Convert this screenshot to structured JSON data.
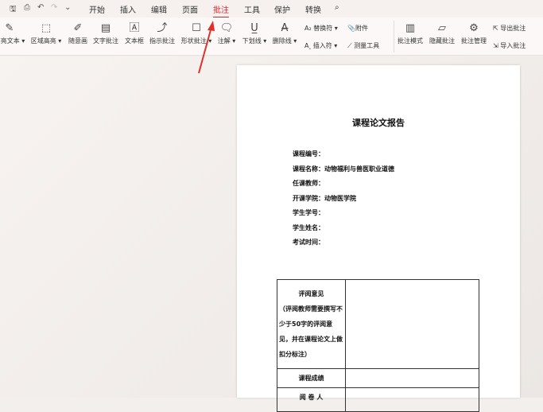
{
  "quick_access": [
    "save-icon",
    "print-icon",
    "undo-icon",
    "redo-icon",
    "more-icon"
  ],
  "tabs": [
    {
      "label": "开始"
    },
    {
      "label": "插入"
    },
    {
      "label": "编辑"
    },
    {
      "label": "页面"
    },
    {
      "label": "批注",
      "active": true
    },
    {
      "label": "工具"
    },
    {
      "label": "保护"
    },
    {
      "label": "转换"
    }
  ],
  "ribbon": {
    "tools": [
      "高亮文本 ▾",
      "区域高亮 ▾",
      "随意画",
      "文字批注",
      "文本框",
      "指示批注",
      "形状批注 ▾",
      "注解 ▾",
      "下划线 ▾",
      "删除线 ▾"
    ],
    "replace": "替换符 ▾",
    "insert": "插入符 ▾",
    "attach": "附件",
    "measure": "测量工具",
    "mode": "批注模式",
    "hide": "隐藏批注",
    "manage": "批注管理",
    "export": "导出批注",
    "import": "导入批注"
  },
  "document": {
    "title": "课程论文报告",
    "fields": [
      "课程编号：",
      "课程名称：动物福利与兽医职业道德",
      "任课教师：",
      "开课学院：动物医学院",
      "学生学号：",
      "学生姓名：",
      "考试时间："
    ],
    "table": {
      "review_label": "评阅意见",
      "review_note": "（评阅教师需要撰写不少于50字的评阅意见，并在课程论文上做扣分标注）",
      "grade_label": "课程成绩",
      "grader_label": "阅 卷 人"
    }
  },
  "accent_color": "#d9272e"
}
